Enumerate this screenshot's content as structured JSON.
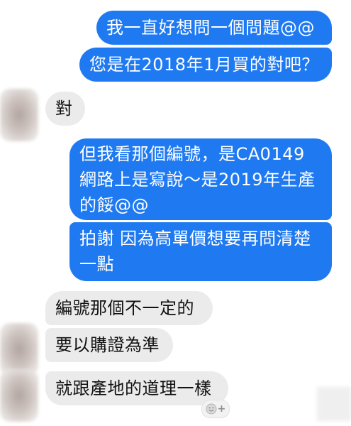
{
  "conversation": {
    "outgoing": [
      {
        "lines": [
          "我一直好想問一個問題@@"
        ]
      },
      {
        "lines": [
          "您是在2018年1月買的對吧？"
        ]
      },
      {
        "lines": [
          "但我看那個編號，是CA0149",
          "網路上是寫說～是2019年生產",
          "的餒@@"
        ]
      },
      {
        "lines": [
          "拍謝 因為高單價想要再問清楚",
          "一點"
        ]
      }
    ],
    "incoming": [
      {
        "lines": [
          "對"
        ]
      },
      {
        "lines": [
          "編號那個不一定的"
        ]
      },
      {
        "lines": [
          "要以購證為準"
        ]
      },
      {
        "lines": [
          "就跟產地的道理一樣"
        ]
      }
    ]
  },
  "reaction": {
    "icon": "smiley-add-icon",
    "plus": "+"
  },
  "colors": {
    "outgoing_bubble": "#1f7af2",
    "incoming_bubble": "#ebebeb",
    "outgoing_text": "#ffffff",
    "incoming_text": "#111111"
  }
}
